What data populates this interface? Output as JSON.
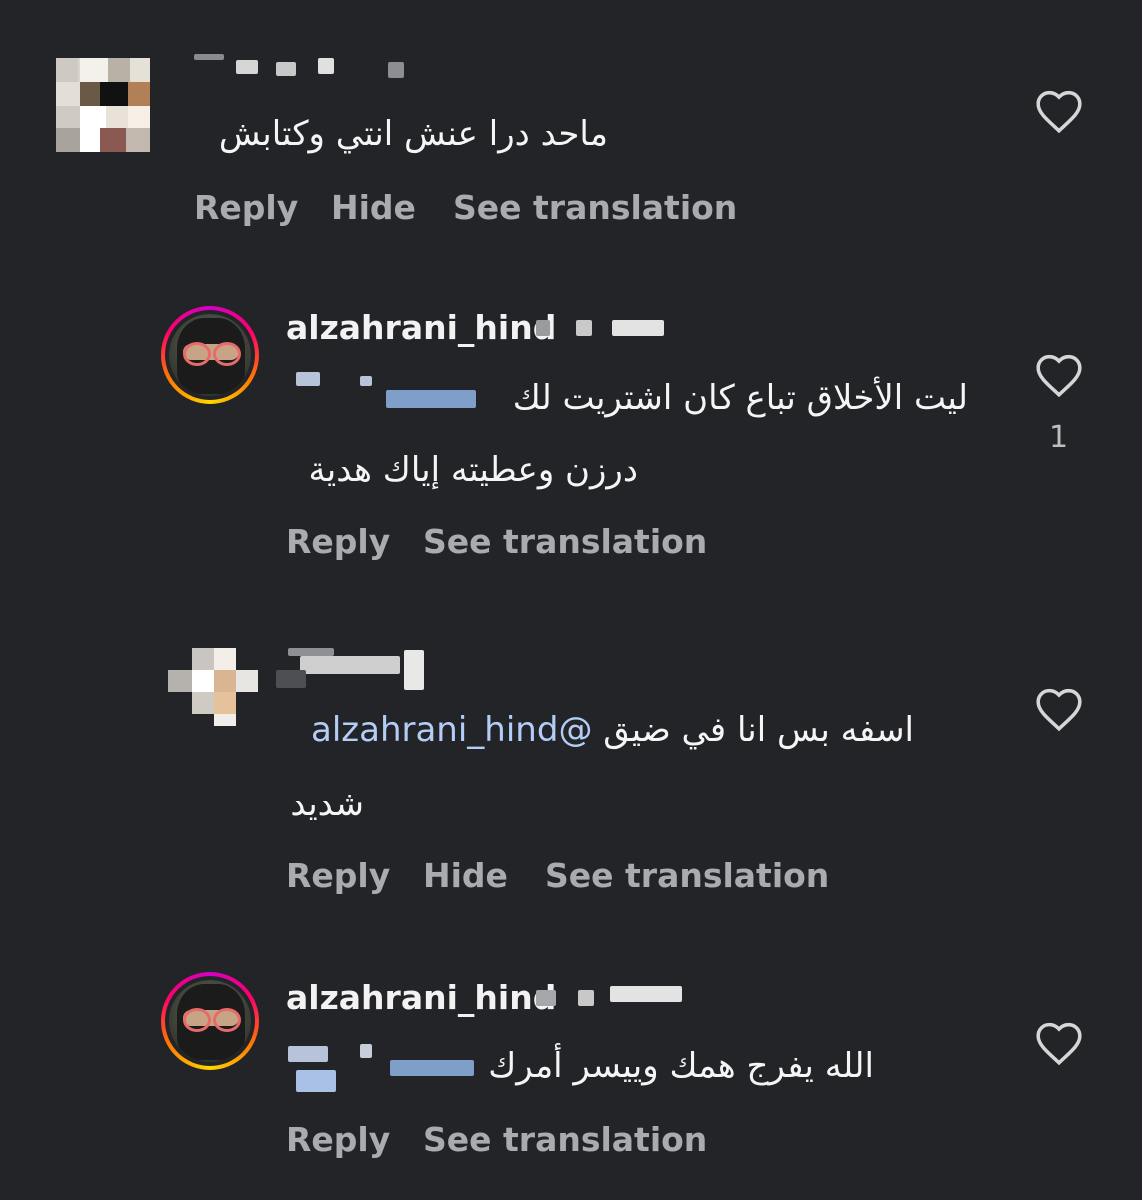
{
  "comments": [
    {
      "text": "ماحد درا عنش انتي وكتابش",
      "actions": {
        "reply": "Reply",
        "hide": "Hide",
        "translate": "See translation"
      }
    },
    {
      "username": "alzahrani_hind",
      "text_line1": "ليت الأخلاق تباع كان اشتريت لك",
      "text_line2": "درزن وعطيته إياك هدية",
      "likes": "1",
      "actions": {
        "reply": "Reply",
        "translate": "See translation"
      }
    },
    {
      "mention": "@alzahrani_hind",
      "text_line1": "اسفه بس انا في ضيق",
      "text_line2": "شديد",
      "actions": {
        "reply": "Reply",
        "hide": "Hide",
        "translate": "See translation"
      }
    },
    {
      "username": "alzahrani_hind",
      "text_line1": "الله يفرج همك وييسر أمرك",
      "actions": {
        "reply": "Reply",
        "translate": "See translation"
      }
    }
  ],
  "icons": {
    "like": "heart-icon"
  },
  "colors": {
    "background": "#232428",
    "mention": "#b3cdf6",
    "action": "#a9abb0"
  }
}
